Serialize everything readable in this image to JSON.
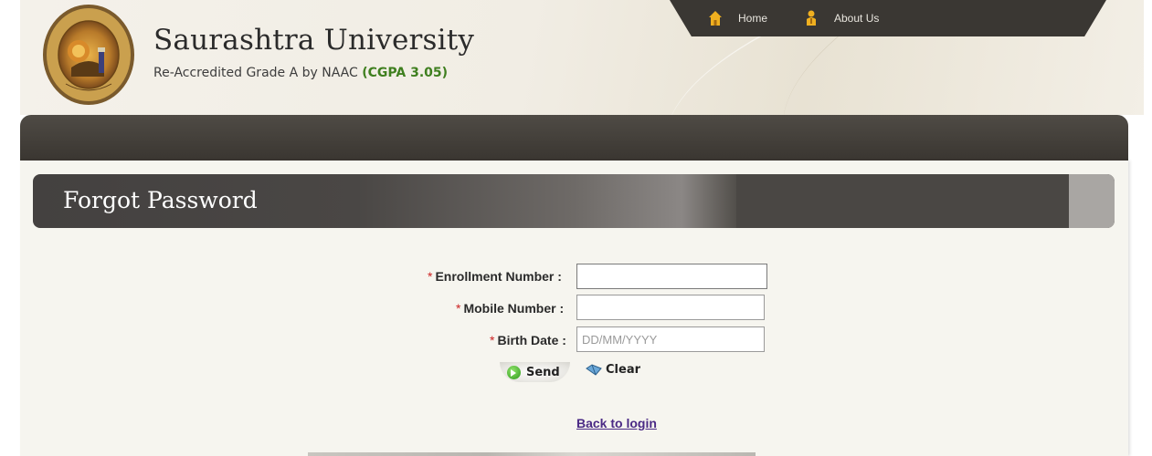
{
  "header": {
    "logo_text_top": "શાભાર્ય સરસ્વતી",
    "logo_text_bottom": "SAURASHTRA UNIVERSITY",
    "title": "Saurashtra University",
    "subtitle_prefix": "Re-Accredited Grade A by NAAC",
    "subtitle_cgpa": "(CGPA 3.05)"
  },
  "topnav": {
    "items": [
      {
        "label": "Home",
        "icon": "home-icon"
      },
      {
        "label": "About Us",
        "icon": "about-us-icon"
      }
    ]
  },
  "page": {
    "title": "Forgot Password"
  },
  "form": {
    "enrollment": {
      "required_mark": "*",
      "label": "Enrollment Number :",
      "value": "",
      "placeholder": ""
    },
    "mobile": {
      "required_mark": "*",
      "label": "Mobile Number :",
      "value": "",
      "placeholder": ""
    },
    "birth_date": {
      "required_mark": "*",
      "label": "Birth Date :",
      "value": "",
      "placeholder": "DD/MM/YYYY"
    },
    "send_label": "Send",
    "clear_label": "Clear",
    "back_link": "Back to login"
  },
  "colors": {
    "cgpa": "#3f7f1f",
    "required": "#cc2222",
    "link": "#4b2a85",
    "nav_bg": "#3a3733"
  }
}
